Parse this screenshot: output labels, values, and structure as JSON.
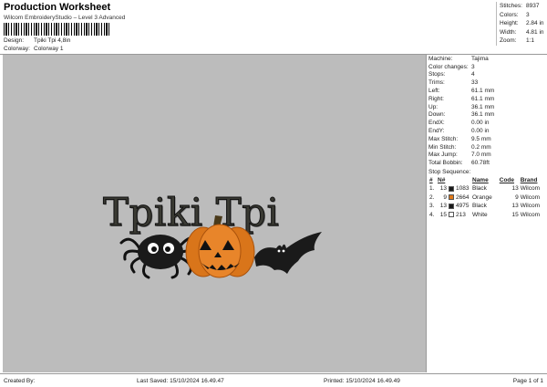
{
  "header": {
    "title": "Production Worksheet",
    "subtitle": "Wilcom EmbroideryStudio – Level 3 Advanced",
    "design_label": "Design:",
    "design_value": "Tpiki Tpi 4,8in",
    "colorway_label": "Colorway:",
    "colorway_value": "Colorway 1"
  },
  "summary": [
    {
      "k": "Stitches:",
      "v": "8937"
    },
    {
      "k": "Colors:",
      "v": "3"
    },
    {
      "k": "Height:",
      "v": "2.84 in"
    },
    {
      "k": "Width:",
      "v": "4.81 in"
    },
    {
      "k": "Zoom:",
      "v": "1:1"
    }
  ],
  "design": {
    "text": "Tpiki Tpi"
  },
  "props": [
    {
      "k": "Machine:",
      "v": "Tajima"
    },
    {
      "k": "Color changes:",
      "v": "3"
    },
    {
      "k": "Stops:",
      "v": "4"
    },
    {
      "k": "Trims:",
      "v": "33"
    },
    {
      "k": "Left:",
      "v": "61.1 mm"
    },
    {
      "k": "Right:",
      "v": "61.1 mm"
    },
    {
      "k": "Up:",
      "v": "36.1 mm"
    },
    {
      "k": "Down:",
      "v": "36.1 mm"
    },
    {
      "k": "EndX:",
      "v": "0.00 in"
    },
    {
      "k": "EndY:",
      "v": "0.00 in"
    },
    {
      "k": "Max Stitch:",
      "v": "9.5 mm"
    },
    {
      "k": "Min Stitch:",
      "v": "0.2 mm"
    },
    {
      "k": "Max Jump:",
      "v": "7.0 mm"
    },
    {
      "k": "Total Bobbin:",
      "v": "60.78ft"
    }
  ],
  "sequence": {
    "title": "Stop Sequence:",
    "headers": [
      "#",
      "N#",
      "",
      "Name",
      "Code",
      "Brand"
    ],
    "rows": [
      {
        "idx": "1.",
        "n": "13",
        "color": "#1a1a1a",
        "num": "1083",
        "name": "Black",
        "code": "13",
        "brand": "Wilcom"
      },
      {
        "idx": "2.",
        "n": "9",
        "color": "#e07a1a",
        "num": "2664",
        "name": "Orange",
        "code": "9",
        "brand": "Wilcom"
      },
      {
        "idx": "3.",
        "n": "13",
        "color": "#1a1a1a",
        "num": "4975",
        "name": "Black",
        "code": "13",
        "brand": "Wilcom"
      },
      {
        "idx": "4.",
        "n": "15",
        "color": "#ffffff",
        "num": "213",
        "name": "White",
        "code": "15",
        "brand": "Wilcom"
      }
    ]
  },
  "footer": {
    "created": "Created By:",
    "saved": "Last Saved: 15/10/2024 16.49.47",
    "printed": "Printed: 15/10/2024 16.49.49",
    "page": "Page 1 of 1"
  }
}
